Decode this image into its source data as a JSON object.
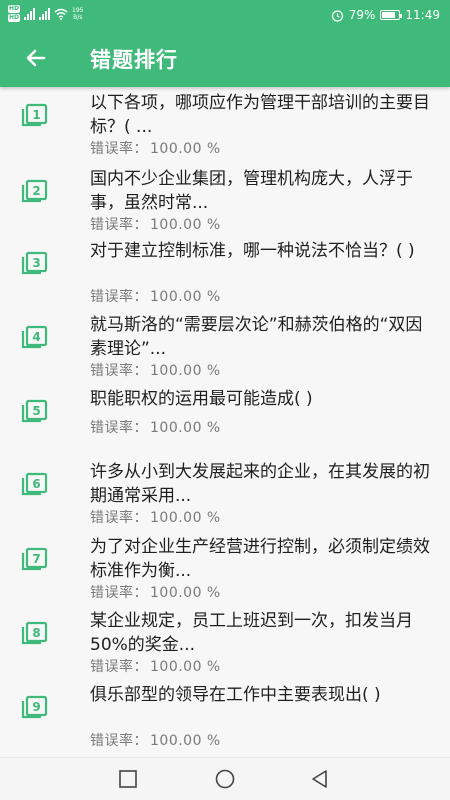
{
  "status": {
    "hd1": "HD",
    "hd2": "HD",
    "net_speed": "195",
    "net_unit": "B/s",
    "battery": "79%",
    "battery_level": 0.79,
    "time": "11:49"
  },
  "header": {
    "title": "错题排行"
  },
  "rate_label": "错误率：",
  "items": [
    {
      "number": "1",
      "question": "以下各项，哪项应作为管理干部培训的主要目标？( ...",
      "rate": "100.00 %"
    },
    {
      "number": "2",
      "question": "国内不少企业集团，管理机构庞大，人浮于事，虽然时常...",
      "rate": "100.00 %"
    },
    {
      "number": "3",
      "question": "对于建立控制标准，哪一种说法不恰当？( )",
      "rate": "100.00 %"
    },
    {
      "number": "4",
      "question": "就马斯洛的“需要层次论”和赫茨伯格的“双因素理论”...",
      "rate": "100.00 %"
    },
    {
      "number": "5",
      "question": "职能职权的运用最可能造成( )",
      "rate": "100.00 %"
    },
    {
      "number": "6",
      "question": "许多从小到大发展起来的企业，在其发展的初期通常采用...",
      "rate": "100.00 %"
    },
    {
      "number": "7",
      "question": "为了对企业生产经营进行控制，必须制定绩效标准作为衡...",
      "rate": "100.00 %"
    },
    {
      "number": "8",
      "question": "某企业规定，员工上班迟到一次，扣发当月50%的奖金...",
      "rate": "100.00 %"
    },
    {
      "number": "9",
      "question": "俱乐部型的领导在工作中主要表现出( )",
      "rate": "100.00 %"
    }
  ],
  "colors": {
    "accent": "#3fba7a",
    "text": "#1f1f1f",
    "muted": "#7a7a7a"
  }
}
